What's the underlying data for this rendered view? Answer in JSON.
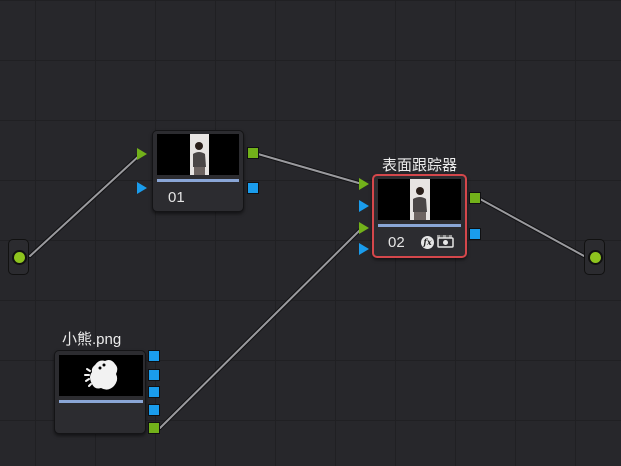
{
  "colors": {
    "background": "#27272b",
    "wire": "#9a9a9e",
    "rgb_port": "#72b11a",
    "alpha_port": "#1a9cec",
    "selected_border": "#d4474b"
  },
  "nodes": {
    "n01": {
      "label": "01"
    },
    "n02": {
      "label": "02",
      "title": "表面跟踪器",
      "fx_label": "fx"
    },
    "bear": {
      "title": "小熊.png"
    }
  },
  "icons": {
    "fx": "fx-icon",
    "camera": "camera-icon",
    "checker": "checker-icon"
  }
}
